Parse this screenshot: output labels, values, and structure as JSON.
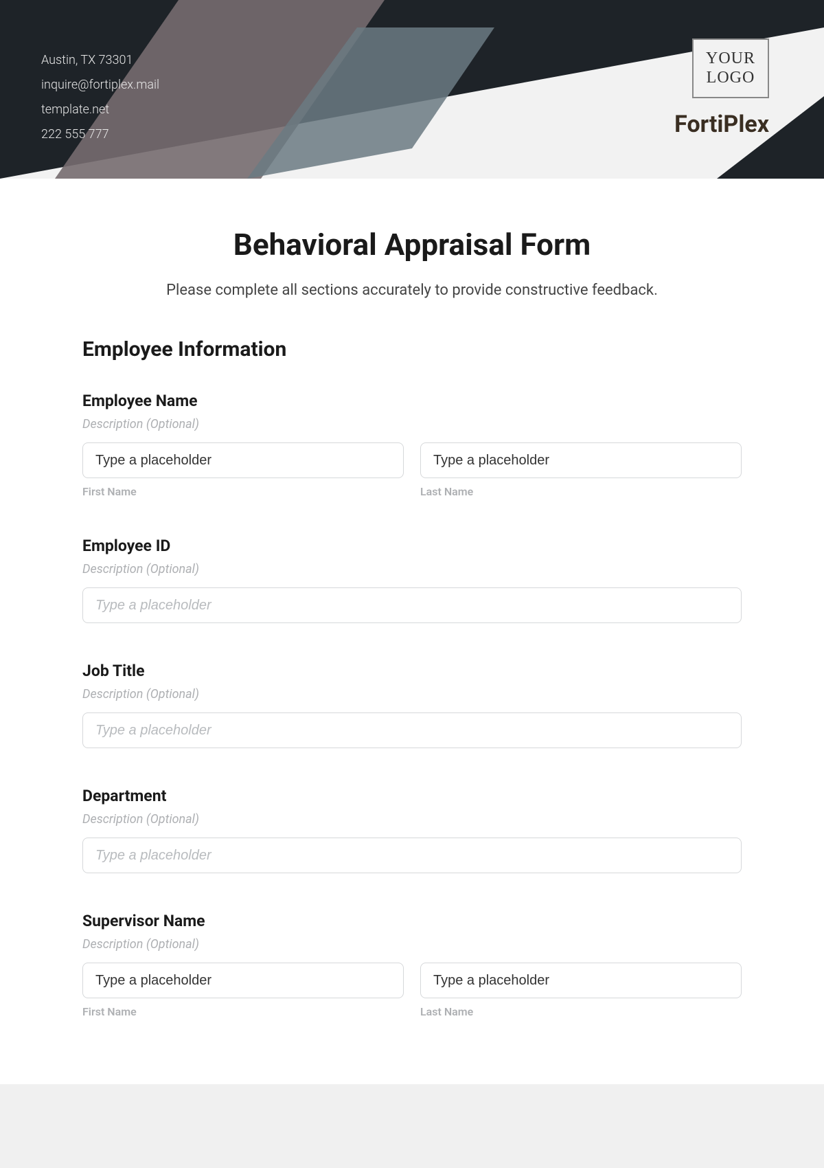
{
  "header": {
    "contact": {
      "address": "Austin, TX 73301",
      "email": "inquire@fortiplex.mail",
      "website": "template.net",
      "phone": "222 555 777"
    },
    "logo_text_line1": "YOUR",
    "logo_text_line2": "LOGO",
    "brand_name": "FortiPlex"
  },
  "form": {
    "title": "Behavioral Appraisal Form",
    "subtitle": "Please complete all sections accurately to provide constructive feedback.",
    "section_heading": "Employee Information",
    "desc_placeholder": "Description (Optional)",
    "input_placeholder": "Type a placeholder",
    "sub_first": "First Name",
    "sub_last": "Last Name",
    "fields": {
      "employee_name": {
        "label": "Employee Name"
      },
      "employee_id": {
        "label": "Employee ID"
      },
      "job_title": {
        "label": "Job Title"
      },
      "department": {
        "label": "Department"
      },
      "supervisor_name": {
        "label": "Supervisor Name"
      }
    }
  }
}
